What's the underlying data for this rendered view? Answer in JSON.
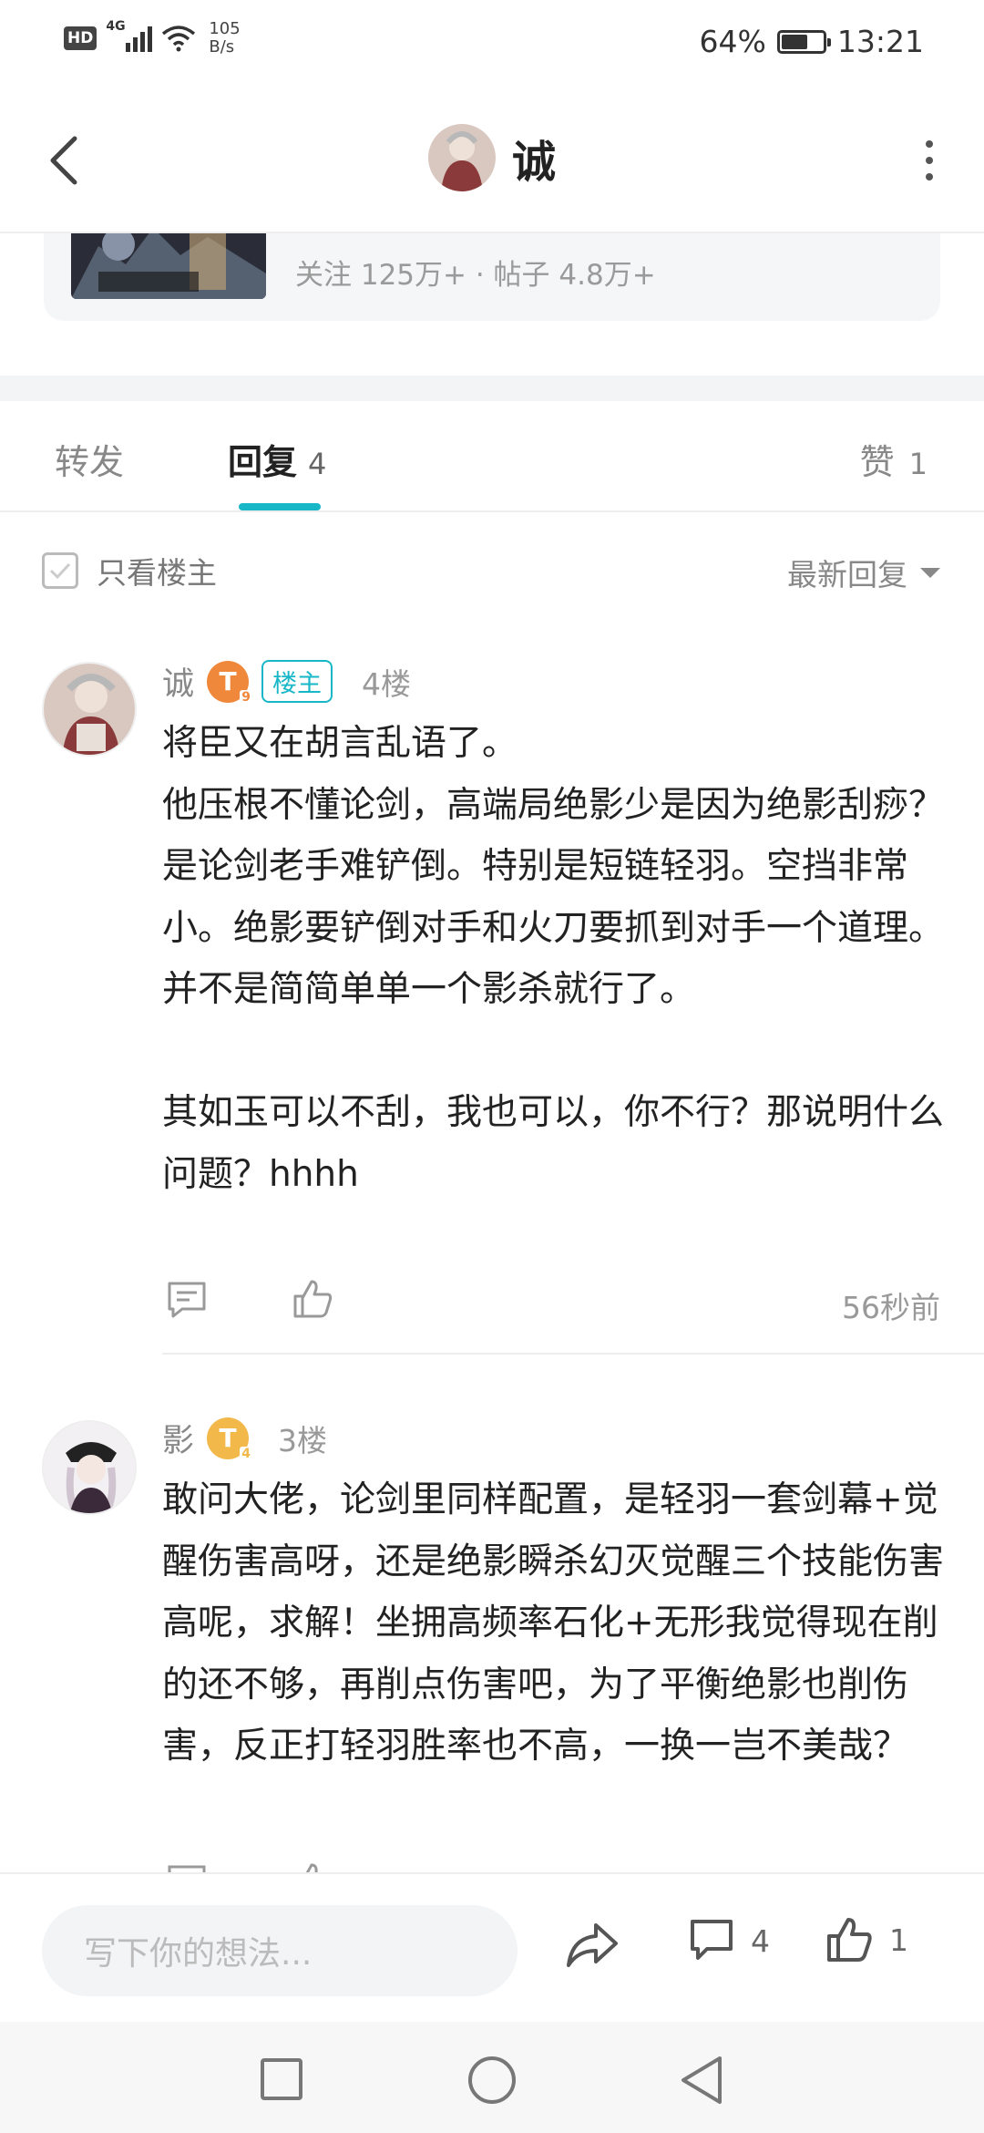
{
  "status_bar": {
    "hd": "HD",
    "network": "4G",
    "speed_value": "105",
    "speed_unit": "B/s",
    "battery_percent": "64%",
    "battery_level": 0.64,
    "time": "13:21"
  },
  "header": {
    "title": "诚",
    "back_icon": "chevron-left-icon",
    "more_icon": "more-vertical-icon"
  },
  "forum": {
    "stats": "关注 125万+ · 帖子 4.8万+"
  },
  "tabs": {
    "forward_label": "转发",
    "reply_label": "回复",
    "reply_count": "4",
    "like_label": "赞",
    "like_count": "1"
  },
  "filter": {
    "only_op_label": "只看楼主",
    "sort_label": "最新回复"
  },
  "replies": [
    {
      "user": "诚",
      "level_letter": "T",
      "level_sub": "9",
      "badge": "楼主",
      "floor": "4楼",
      "content": "将臣又在胡言乱语了。\n他压根不懂论剑，高端局绝影少是因为绝影刮痧？\n是论剑老手难铲倒。特别是短链轻羽。空挡非常小。绝影要铲倒对手和火刀要抓到对手一个道理。并不是简简单单一个影杀就行了。\n\n其如玉可以不刮，我也可以，你不行？那说明什么问题？hhhh",
      "time": "56秒前"
    },
    {
      "user": "影",
      "level_letter": "T",
      "level_sub": "4",
      "floor": "3楼",
      "content": "敢问大佬，论剑里同样配置，是轻羽一套剑幕+觉醒伤害高呀，还是绝影瞬杀幻灭觉醒三个技能伤害高呢，求解！坐拥高频率石化+无形我觉得现在削的还不够，再削点伤害吧，为了平衡绝影也削伤害，反正打轻羽胜率也不高，一换一岂不美哉？"
    }
  ],
  "bottom_bar": {
    "input_placeholder": "写下你的想法...",
    "comment_count": "4",
    "like_count": "1"
  },
  "colors": {
    "accent": "#17b7c7",
    "level_orange": "#f0883b",
    "level_yellow": "#f2b84a"
  }
}
